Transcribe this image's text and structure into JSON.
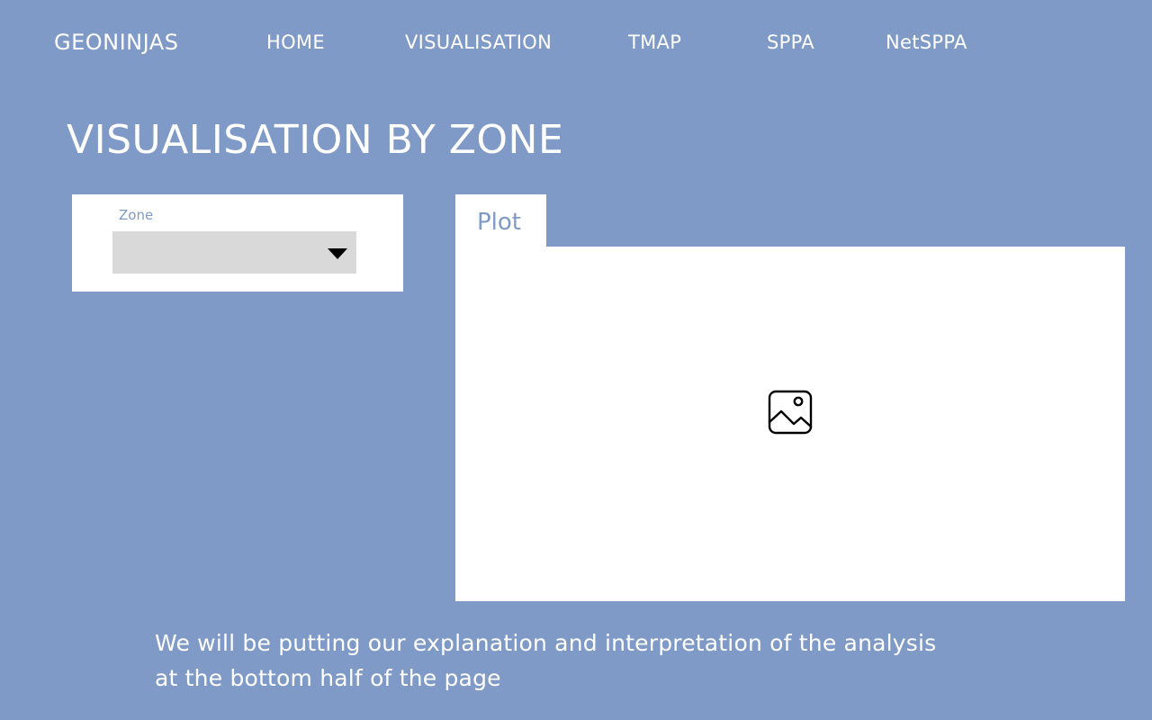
{
  "nav": {
    "brand": "GEONINJAS",
    "links": [
      {
        "label": "HOME"
      },
      {
        "label": "VISUALISATION"
      },
      {
        "label": "TMAP"
      },
      {
        "label": "SPPA"
      },
      {
        "label": "NetSPPA"
      }
    ]
  },
  "page": {
    "title": "VISUALISATION BY ZONE"
  },
  "filter": {
    "zone_label": "Zone",
    "zone_selected": "",
    "caret_icon": "caret-down-icon"
  },
  "tabs": [
    {
      "label": "Plot",
      "active": true
    }
  ],
  "plot": {
    "placeholder_icon": "image-icon"
  },
  "explanation": {
    "line1": "We will be putting our explanation and interpretation of the analysis",
    "line2": "at the bottom half of the page"
  },
  "colors": {
    "background": "#7f9ac7",
    "panel": "#ffffff",
    "select": "#d9d9d9",
    "accent_text": "#7f9ac7"
  }
}
